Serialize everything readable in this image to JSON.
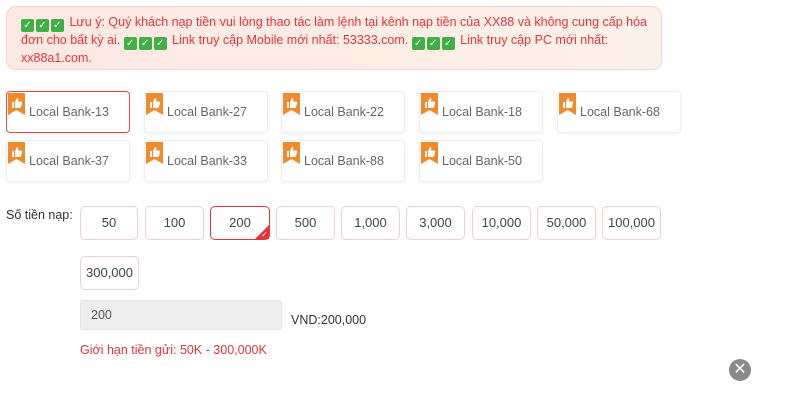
{
  "notice": {
    "icon": "check-box-icon",
    "label": "Lưu ý:",
    "text1": " Quý khách nạp tiền vui lòng thao tác làm lệnh tại kênh nạp tiền của XX88 và không cung cấp hóa đơn cho bất kỳ ai. ",
    "text2": " Link truy cập Mobile mới nhất: 53333.com. ",
    "text3": " Link truy cập PC mới nhất: xx88a1.com."
  },
  "banks": [
    {
      "label": "Local Bank-13",
      "selected": true
    },
    {
      "label": "Local Bank-27",
      "selected": false
    },
    {
      "label": "Local Bank-22",
      "selected": false
    },
    {
      "label": "Local Bank-18",
      "selected": false
    },
    {
      "label": "Local Bank-68",
      "selected": false
    },
    {
      "label": "Local Bank-37",
      "selected": false
    },
    {
      "label": "Local Bank-33",
      "selected": false
    },
    {
      "label": "Local Bank-88",
      "selected": false
    },
    {
      "label": "Local Bank-50",
      "selected": false
    }
  ],
  "amount_label": "Số tiền nạp:",
  "amounts": [
    "50",
    "100",
    "200",
    "500",
    "1,000",
    "3,000",
    "10,000",
    "50,000",
    "100,000",
    "300,000"
  ],
  "selected_amount": "200",
  "input_value": "200",
  "vnd_text": "VND:200,000",
  "limit_text": "Giới hạn tiền gửi:  50K  - 300,000K",
  "colors": {
    "accent": "#e3343a",
    "badge": "#f08a2a"
  }
}
